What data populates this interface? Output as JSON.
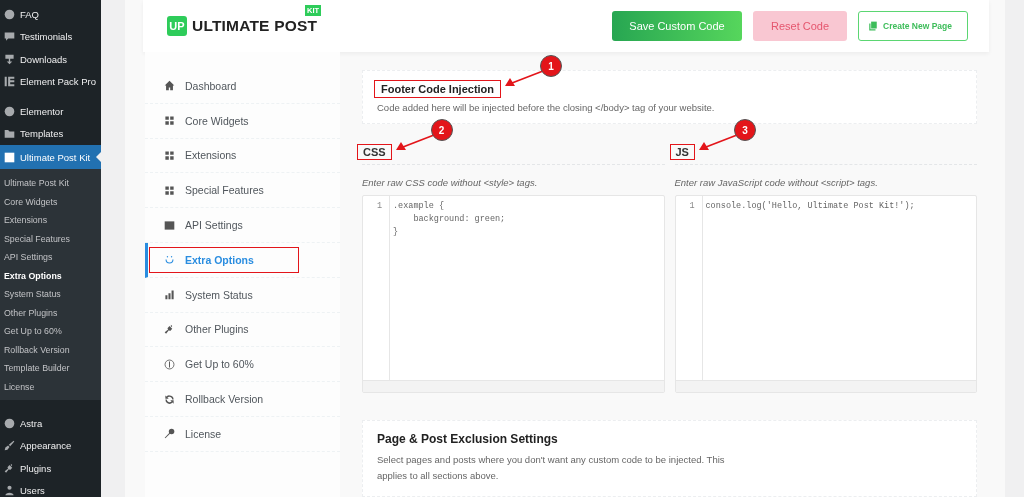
{
  "wp_menu": {
    "items": [
      {
        "label": "FAQ",
        "selected": false
      },
      {
        "label": "Testimonials",
        "selected": false
      },
      {
        "label": "Downloads",
        "selected": false
      },
      {
        "label": "Element Pack Pro",
        "selected": false
      },
      {
        "label": "Elementor",
        "selected": false
      },
      {
        "label": "Templates",
        "selected": false
      },
      {
        "label": "Ultimate Post Kit",
        "selected": true,
        "children": [
          {
            "label": "Ultimate Post Kit",
            "selected": false
          },
          {
            "label": "Core Widgets",
            "selected": false
          },
          {
            "label": "Extensions",
            "selected": false
          },
          {
            "label": "Special Features",
            "selected": false
          },
          {
            "label": "API Settings",
            "selected": false
          },
          {
            "label": "Extra Options",
            "selected": true
          },
          {
            "label": "System Status",
            "selected": false
          },
          {
            "label": "Other Plugins",
            "selected": false
          },
          {
            "label": "Get Up to 60%",
            "selected": false
          },
          {
            "label": "Rollback Version",
            "selected": false
          },
          {
            "label": "Template Builder",
            "selected": false
          },
          {
            "label": "License",
            "selected": false
          }
        ]
      },
      {
        "label": "Astra",
        "selected": false
      },
      {
        "label": "Appearance",
        "selected": false
      },
      {
        "label": "Plugins",
        "selected": false
      },
      {
        "label": "Users",
        "selected": false
      }
    ]
  },
  "header": {
    "logo": {
      "mark": "UP",
      "text": "ULTIMATE POST",
      "badge": "KIT"
    },
    "buttons": [
      {
        "label": "Save Custom Code",
        "kind": "primary"
      },
      {
        "label": "Reset Code",
        "kind": "danger"
      },
      {
        "label": "Create New Page",
        "kind": "outline"
      }
    ]
  },
  "nav": [
    {
      "label": "Dashboard",
      "selected": false,
      "highlighted": false
    },
    {
      "label": "Core Widgets",
      "selected": false,
      "highlighted": false
    },
    {
      "label": "Extensions",
      "selected": false,
      "highlighted": false
    },
    {
      "label": "Special Features",
      "selected": false,
      "highlighted": false
    },
    {
      "label": "API Settings",
      "selected": false,
      "highlighted": false
    },
    {
      "label": "Extra Options",
      "selected": true,
      "highlighted": true
    },
    {
      "label": "System Status",
      "selected": false,
      "highlighted": false
    },
    {
      "label": "Other Plugins",
      "selected": false,
      "highlighted": false
    },
    {
      "label": "Get Up to 60%",
      "selected": false,
      "highlighted": false
    },
    {
      "label": "Rollback Version",
      "selected": false,
      "highlighted": false
    },
    {
      "label": "License",
      "selected": false,
      "highlighted": false
    }
  ],
  "footer_section": {
    "title": "Footer Code Injection",
    "highlighted": true,
    "callout": "1",
    "description": "Code added here will be injected before the closing </body> tag of your website."
  },
  "editors": [
    {
      "title": "CSS",
      "highlighted": true,
      "callout": "2",
      "hint": "Enter raw CSS code without <style> tags.",
      "lines": [
        ".example {",
        "    background: green;",
        "}"
      ],
      "line_numbers": [
        "1"
      ]
    },
    {
      "title": "JS",
      "highlighted": true,
      "callout": "3",
      "hint": "Enter raw JavaScript code without <script> tags.",
      "lines": [
        "console.log('Hello, Ultimate Post Kit!');"
      ],
      "line_numbers": [
        "1"
      ]
    }
  ],
  "exclusion": {
    "title": "Page & Post Exclusion Settings",
    "description": "Select pages and posts where you don't want any custom code to be injected. This applies to all sections above."
  }
}
